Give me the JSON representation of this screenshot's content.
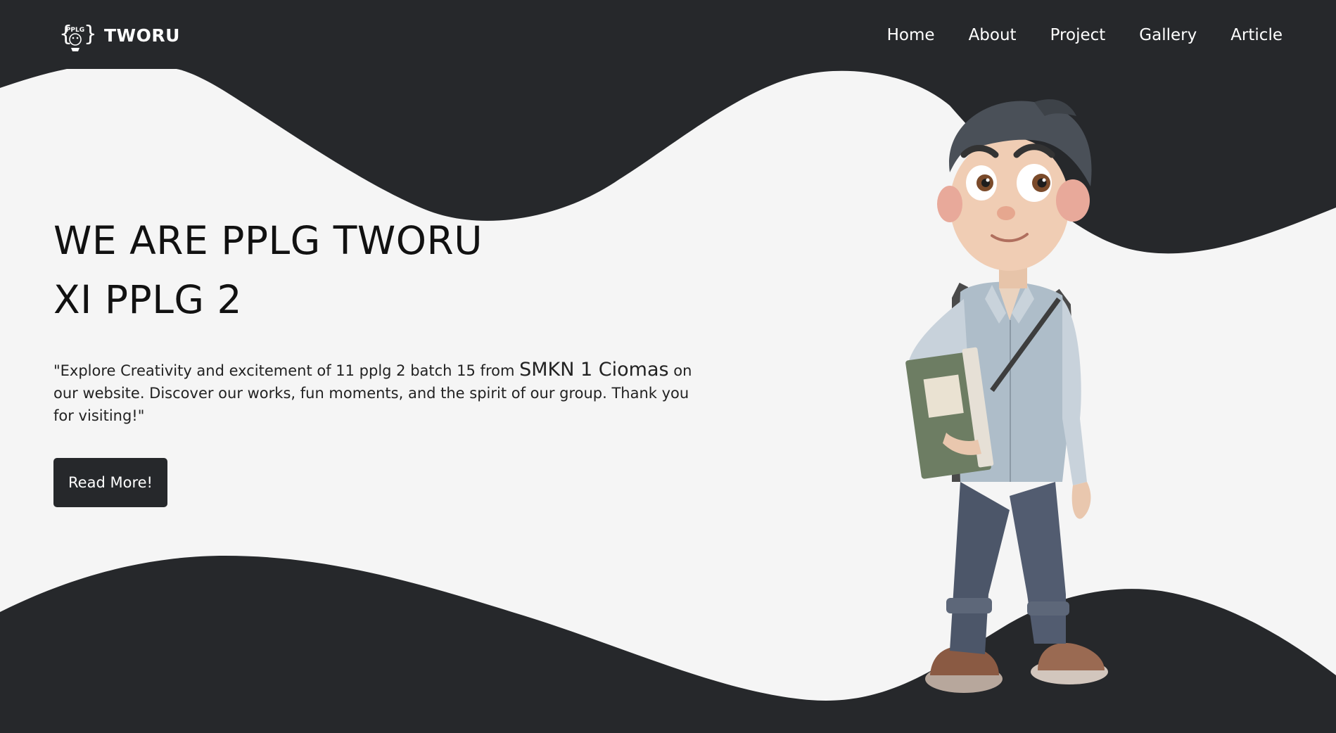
{
  "brand": {
    "name": "TWORU",
    "logo_text": "PPLG",
    "logo_icon": "pplg-logo-icon"
  },
  "nav": {
    "items": [
      {
        "label": "Home"
      },
      {
        "label": "About"
      },
      {
        "label": "Project"
      },
      {
        "label": "Gallery"
      },
      {
        "label": "Article"
      }
    ]
  },
  "hero": {
    "title_line1": "WE ARE PPLG TWORU",
    "title_line2": "XI PPLG 2",
    "desc_before": "\"Explore Creativity and excitement of 11 pplg 2 batch 15 from ",
    "desc_school": "SMKN 1 Ciomas",
    "desc_after": " on our website. Discover our works, fun moments, and the spirit of our group. Thank you for visiting!\"",
    "button_label": "Read More!"
  },
  "illustration": {
    "icon": "student-character-illustration"
  },
  "colors": {
    "dark": "#26282b",
    "light": "#f5f5f5",
    "text": "#111111"
  }
}
